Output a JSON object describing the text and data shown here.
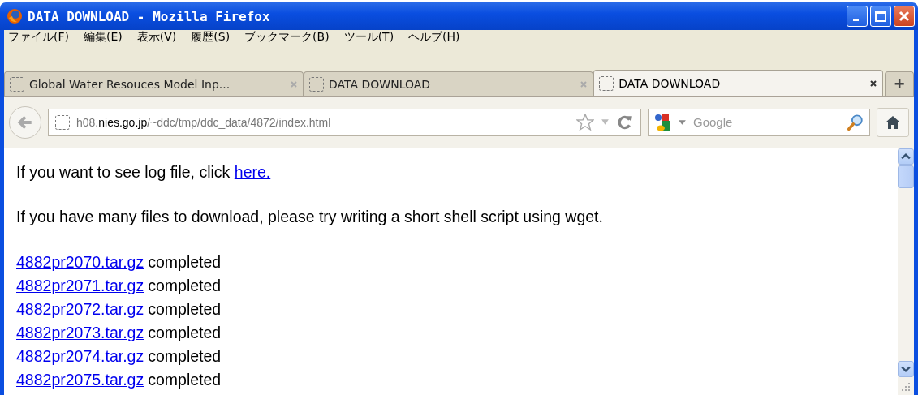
{
  "window": {
    "title": "DATA DOWNLOAD - Mozilla Firefox"
  },
  "menu": [
    "ファイル(F)",
    "編集(E)",
    "表示(V)",
    "履歴(S)",
    "ブックマーク(B)",
    "ツール(T)",
    "ヘルプ(H)"
  ],
  "tabs": [
    {
      "label": "Global Water Resouces Model Inp...",
      "selected": false
    },
    {
      "label": "DATA DOWNLOAD",
      "selected": false
    },
    {
      "label": "DATA DOWNLOAD",
      "selected": true
    }
  ],
  "new_tab": "+",
  "address": {
    "host_prefix": "h08.",
    "host": "nies.go.jp",
    "path": "/~ddc/tmp/ddc_data/4872/index.html"
  },
  "search": {
    "placeholder": "Google"
  },
  "page": {
    "log_text": "If you want to see log file, click ",
    "log_link": "here.",
    "tip": "If you have many files to download, please try writing a short shell script using wget.",
    "files": [
      {
        "name": "4882pr2070.tar.gz",
        "status": "completed"
      },
      {
        "name": "4882pr2071.tar.gz",
        "status": "completed"
      },
      {
        "name": "4882pr2072.tar.gz",
        "status": "completed"
      },
      {
        "name": "4882pr2073.tar.gz",
        "status": "completed"
      },
      {
        "name": "4882pr2074.tar.gz",
        "status": "completed"
      },
      {
        "name": "4882pr2075.tar.gz",
        "status": "completed"
      }
    ]
  }
}
